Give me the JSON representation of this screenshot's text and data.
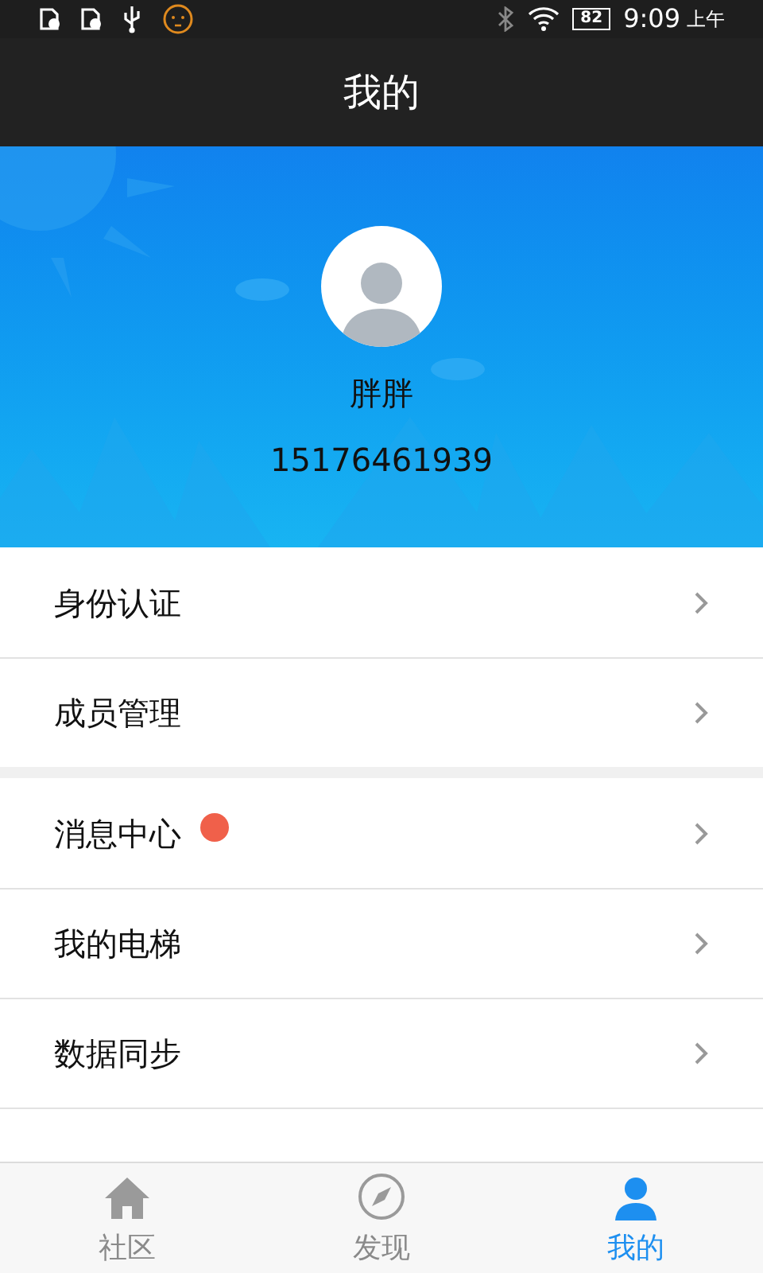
{
  "status_bar": {
    "battery": "82",
    "time": "9:09",
    "period": "上午"
  },
  "title": "我的",
  "profile": {
    "name": "胖胖",
    "phone": "15176461939"
  },
  "menu_groups": [
    {
      "items": [
        {
          "label": "身份认证"
        },
        {
          "label": "成员管理"
        }
      ]
    },
    {
      "items": [
        {
          "label": "消息中心",
          "color": "#f0604a"
        },
        {
          "label": "我的电梯"
        },
        {
          "label": "数据同步"
        }
      ]
    }
  ],
  "tabs": [
    {
      "label": "社区",
      "kind": "home",
      "selected": false
    },
    {
      "label": "发现",
      "kind": "compass",
      "selected": false
    },
    {
      "label": "我的",
      "kind": "person",
      "selected": true
    }
  ]
}
